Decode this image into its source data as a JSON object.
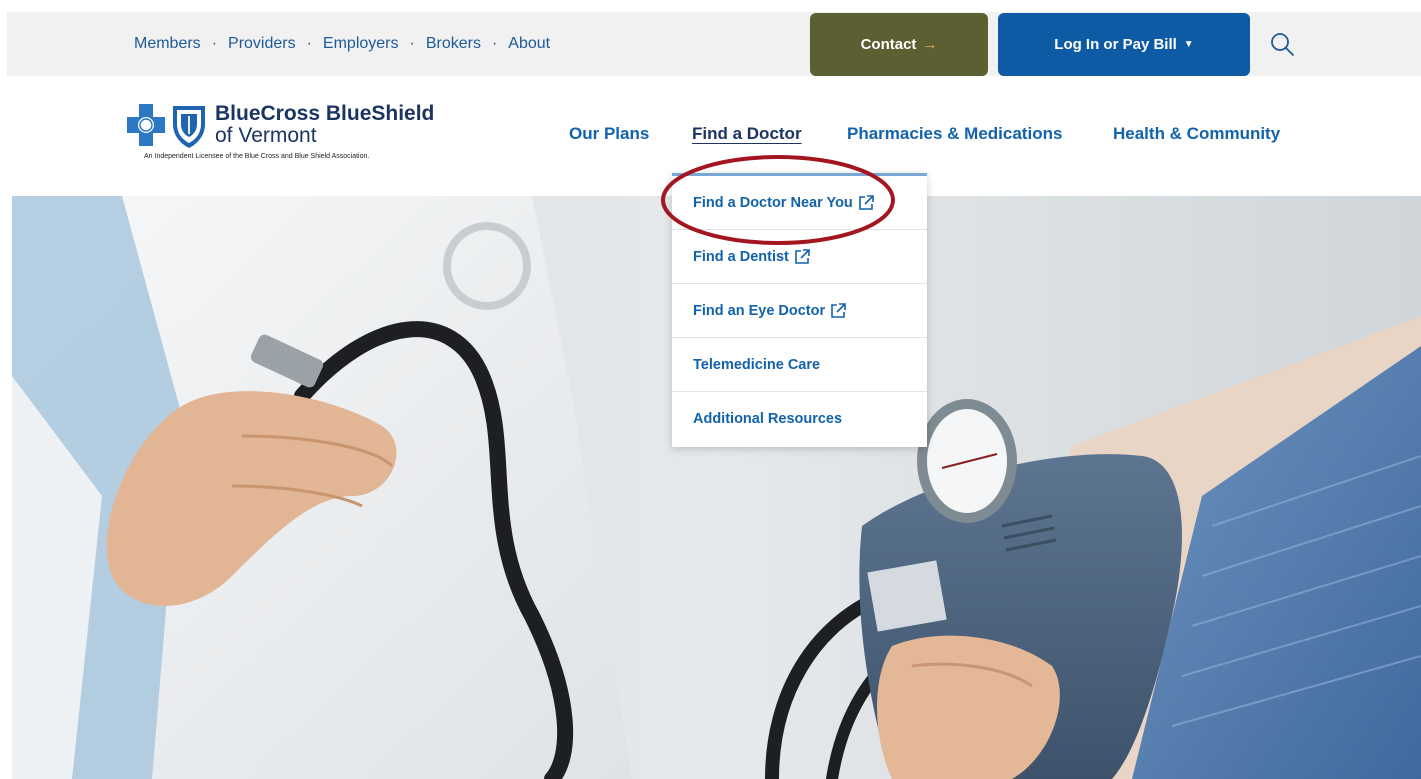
{
  "utility": {
    "links": [
      "Members",
      "Providers",
      "Employers",
      "Brokers",
      "About"
    ],
    "separator": "·",
    "contact_label": "Contact",
    "contact_arrow": "→",
    "login_label": "Log In or Pay Bill",
    "login_caret": "▼",
    "search_icon": "search-icon"
  },
  "logo": {
    "brand": "BlueCross BlueShield",
    "sub": "of Vermont",
    "tagline": "An Independent Licensee of the Blue Cross and Blue Shield Association."
  },
  "nav": {
    "items": [
      "Our Plans",
      "Find a Doctor",
      "Pharmacies & Medications",
      "Health & Community"
    ],
    "active": "Find a Doctor"
  },
  "dropdown": {
    "items": [
      {
        "label": "Find a Doctor Near You",
        "external": true
      },
      {
        "label": "Find a Dentist",
        "external": true
      },
      {
        "label": "Find an Eye Doctor",
        "external": true
      },
      {
        "label": "Telemedicine Care",
        "external": false
      },
      {
        "label": "Additional Resources",
        "external": false
      }
    ]
  },
  "colors": {
    "link_blue": "#1263ad",
    "navy": "#1b3563",
    "contact_olive": "#5c5f32",
    "login_blue": "#0d5ba5",
    "highlight_red": "#a3151f"
  }
}
